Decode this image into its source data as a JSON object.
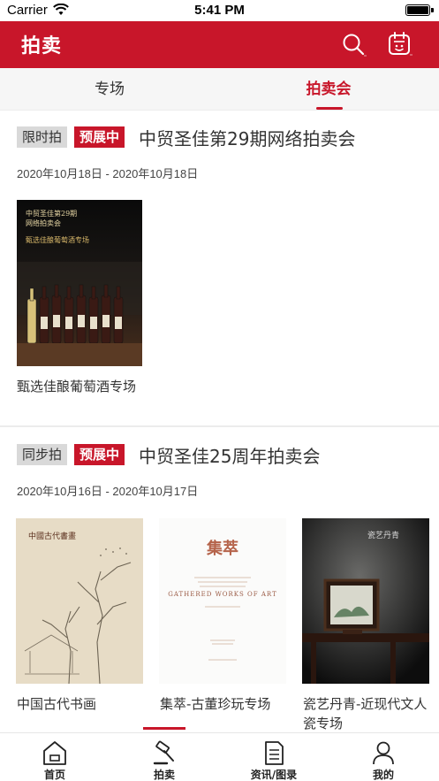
{
  "status_bar": {
    "carrier": "Carrier",
    "time": "5:41 PM"
  },
  "header": {
    "title": "拍卖"
  },
  "tabs": [
    {
      "label": "专场",
      "active": false
    },
    {
      "label": "拍卖会",
      "active": true
    }
  ],
  "auctions": [
    {
      "type_badge": "限时拍",
      "status_badge": "预展中",
      "title": "中贸圣佳第29期网络拍卖会",
      "date_range": "2020年10月18日 - 2020年10月18日",
      "sessions": [
        {
          "label": "甄选佳酿葡萄酒专场",
          "cover": {
            "line1": "中贸圣佳第29期",
            "line2": "网络拍卖会",
            "line3": "甄选佳酿葡萄酒专场"
          }
        }
      ]
    },
    {
      "type_badge": "同步拍",
      "status_badge": "预展中",
      "title": "中贸圣佳25周年拍卖会",
      "date_range": "2020年10月16日 - 2020年10月17日",
      "sessions": [
        {
          "label": "中国古代书画",
          "cover": {
            "line1": "中國古代書畫"
          }
        },
        {
          "label": "集萃-古董珍玩专场",
          "cover": {
            "line1": "集萃",
            "line2": "GATHERED WORKS OF ART"
          }
        },
        {
          "label": "瓷艺丹青-近现代文人瓷专场",
          "cover": {
            "line1": "瓷艺丹青"
          }
        }
      ]
    }
  ],
  "bottom_nav": [
    {
      "label": "首页",
      "icon": "home-icon",
      "active": false
    },
    {
      "label": "拍卖",
      "icon": "gavel-icon",
      "active": true
    },
    {
      "label": "资讯/图录",
      "icon": "document-icon",
      "active": false
    },
    {
      "label": "我的",
      "icon": "person-icon",
      "active": false
    }
  ],
  "colors": {
    "brand": "#c8162a",
    "badge_gray": "#d9d9d9"
  }
}
